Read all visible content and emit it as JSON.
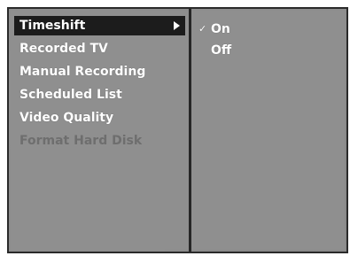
{
  "menu": {
    "items": [
      {
        "label": "Timeshift",
        "state": "selected"
      },
      {
        "label": "Recorded TV",
        "state": "enabled"
      },
      {
        "label": "Manual Recording",
        "state": "enabled"
      },
      {
        "label": "Scheduled List",
        "state": "enabled"
      },
      {
        "label": "Video Quality",
        "state": "enabled"
      },
      {
        "label": "Format Hard Disk",
        "state": "disabled"
      }
    ],
    "submenu_arrow_icon": "triangle-right-icon"
  },
  "submenu": {
    "options": [
      {
        "label": "On",
        "checked": true,
        "check_glyph": "✓"
      },
      {
        "label": "Off",
        "checked": false,
        "check_glyph": ""
      }
    ],
    "check_icon": "checkmark-icon"
  },
  "colors": {
    "panel": "#8f8f8f",
    "highlight": "#1c1c1c",
    "text": "#ffffff",
    "disabled_text": "#6e6e6e",
    "divider": "#262626"
  }
}
